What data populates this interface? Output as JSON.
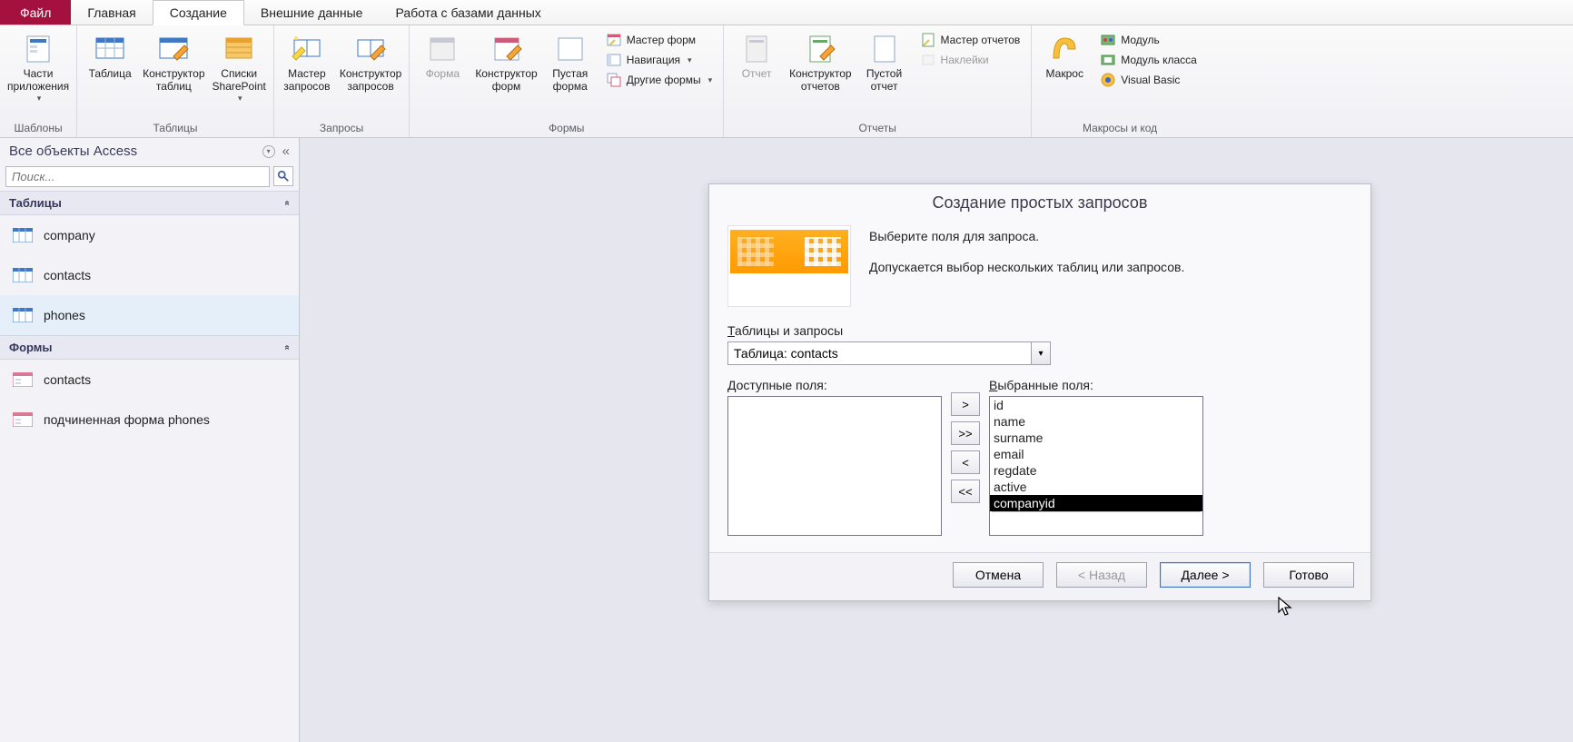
{
  "top": {
    "file": "Файл",
    "tabs": [
      "Главная",
      "Создание",
      "Внешние данные",
      "Работа с базами данных"
    ],
    "active_index": 1
  },
  "ribbon": {
    "groups": [
      {
        "label": "Шаблоны",
        "big": [
          {
            "name": "app-parts",
            "label": "Части\nприложения",
            "dropdown": true
          }
        ]
      },
      {
        "label": "Таблицы",
        "big": [
          {
            "name": "table",
            "label": "Таблица"
          },
          {
            "name": "table-designer",
            "label": "Конструктор\nтаблиц"
          },
          {
            "name": "sharepoint-lists",
            "label": "Списки\nSharePoint",
            "dropdown": true
          }
        ]
      },
      {
        "label": "Запросы",
        "big": [
          {
            "name": "query-wizard",
            "label": "Мастер\nзапросов"
          },
          {
            "name": "query-designer",
            "label": "Конструктор\nзапросов"
          }
        ]
      },
      {
        "label": "Формы",
        "big": [
          {
            "name": "form",
            "label": "Форма",
            "disabled": true
          },
          {
            "name": "form-designer",
            "label": "Конструктор\nформ"
          },
          {
            "name": "blank-form",
            "label": "Пустая\nформа"
          }
        ],
        "small": [
          {
            "name": "form-wizard",
            "label": "Мастер форм"
          },
          {
            "name": "navigation",
            "label": "Навигация",
            "dropdown": true
          },
          {
            "name": "more-forms",
            "label": "Другие формы",
            "dropdown": true
          }
        ]
      },
      {
        "label": "Отчеты",
        "big": [
          {
            "name": "report",
            "label": "Отчет",
            "disabled": true
          },
          {
            "name": "report-designer",
            "label": "Конструктор\nотчетов"
          },
          {
            "name": "blank-report",
            "label": "Пустой\nотчет"
          }
        ],
        "small": [
          {
            "name": "report-wizard",
            "label": "Мастер отчетов"
          },
          {
            "name": "labels",
            "label": "Наклейки",
            "disabled": true
          }
        ]
      },
      {
        "label": "Макросы и код",
        "big": [
          {
            "name": "macros",
            "label": "Макрос"
          }
        ],
        "small": [
          {
            "name": "module",
            "label": "Модуль"
          },
          {
            "name": "class-module",
            "label": "Модуль класса"
          },
          {
            "name": "visual-basic",
            "label": "Visual Basic"
          }
        ]
      }
    ]
  },
  "nav": {
    "title": "Все объекты Access",
    "search_placeholder": "Поиск...",
    "sections": [
      {
        "title": "Таблицы",
        "items": [
          {
            "name": "company",
            "label": "company",
            "icon": "table"
          },
          {
            "name": "contacts",
            "label": "contacts",
            "icon": "table"
          },
          {
            "name": "phones",
            "label": "phones",
            "icon": "table",
            "selected": true
          }
        ]
      },
      {
        "title": "Формы",
        "items": [
          {
            "name": "contacts-form",
            "label": "contacts",
            "icon": "form"
          },
          {
            "name": "phones-subform",
            "label": "подчиненная форма phones",
            "icon": "form"
          }
        ]
      }
    ]
  },
  "wizard": {
    "title": "Создание простых запросов",
    "intro1": "Выберите поля для запроса.",
    "intro2": "Допускается выбор нескольких таблиц или запросов.",
    "tables_label_pre": "Т",
    "tables_label_rest": "аблицы и запросы",
    "combo_value": "Таблица: contacts",
    "available_pre": "Д",
    "available_rest": "оступные поля:",
    "selected_pre": "В",
    "selected_rest": "ыбранные поля:",
    "available_fields": [],
    "selected_fields": [
      "id",
      "name",
      "surname",
      "email",
      "regdate",
      "active",
      "companyid"
    ],
    "selected_highlight_index": 6,
    "move": {
      "add": ">",
      "addall": ">>",
      "remove": "<",
      "removeall": "<<"
    },
    "buttons": {
      "cancel": "Отмена",
      "back": "< Назад",
      "next": "Далее >",
      "finish": "Готово"
    }
  }
}
